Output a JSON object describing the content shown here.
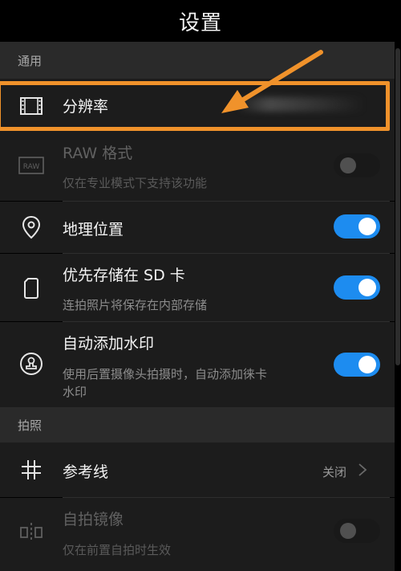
{
  "header": {
    "title": "设置"
  },
  "sections": {
    "general": "通用",
    "photo": "拍照"
  },
  "items": {
    "resolution": {
      "label": "分辨率",
      "icon": "resolution-frame-icon"
    },
    "raw": {
      "label": "RAW 格式",
      "sub": "仅在专业模式下支持该功能",
      "icon": "raw-icon",
      "toggle_on": false,
      "disabled": true
    },
    "location": {
      "label": "地理位置",
      "icon": "location-pin-icon",
      "toggle_on": true
    },
    "sd": {
      "label": "优先存储在 SD 卡",
      "sub": "连拍照片将保存在内部存储",
      "icon": "sd-card-icon",
      "toggle_on": true
    },
    "watermark": {
      "label": "自动添加水印",
      "sub1": "使用后置摄像头拍摄时，自动添加徕卡",
      "sub2": "水印",
      "icon": "watermark-stamp-icon",
      "toggle_on": true
    },
    "gridline": {
      "label": "参考线",
      "value": "关闭",
      "icon": "grid-icon"
    },
    "mirror": {
      "label": "自拍镜像",
      "sub": "仅在前置自拍时生效",
      "icon": "mirror-icon",
      "toggle_on": false,
      "disabled": true
    }
  },
  "colors": {
    "accent": "#1d8cf0",
    "annotation": "#f0922b",
    "row_bg": "#1c1c1c",
    "section_bg": "#2a2a2a"
  }
}
